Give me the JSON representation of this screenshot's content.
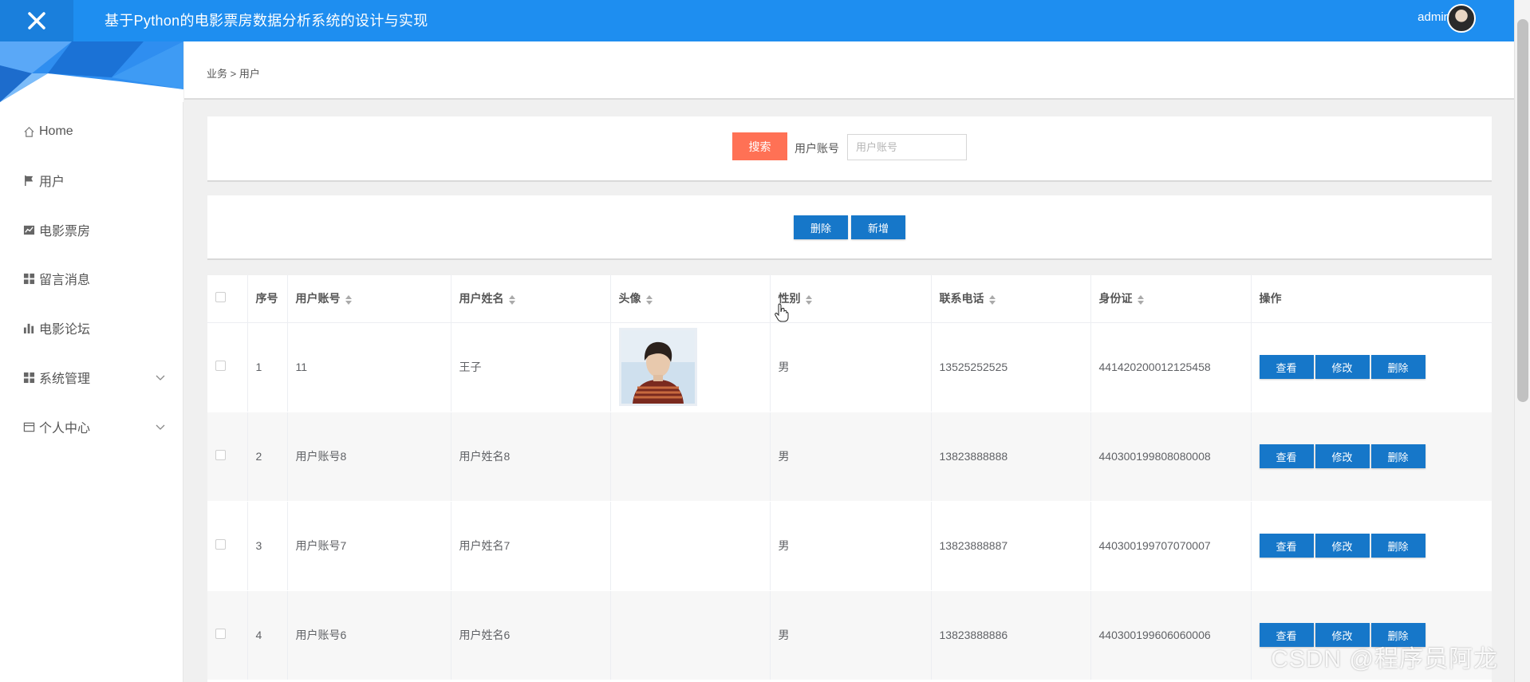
{
  "header": {
    "app_title": "基于Python的电影票房数据分析系统的设计与实现",
    "user_name": "admin",
    "brand_color": "#1e8ef0"
  },
  "sidebar": {
    "items": [
      {
        "label": "Home",
        "icon": "home-icon"
      },
      {
        "label": "用户",
        "icon": "flag-icon"
      },
      {
        "label": "电影票房",
        "icon": "chart-icon"
      },
      {
        "label": "留言消息",
        "icon": "grid-icon"
      },
      {
        "label": "电影论坛",
        "icon": "bar-chart-icon"
      },
      {
        "label": "系统管理",
        "icon": "grid-icon",
        "has_children": true
      },
      {
        "label": "个人中心",
        "icon": "card-icon",
        "has_children": true
      }
    ]
  },
  "breadcrumb": "业务 > 用户",
  "search": {
    "button_label": "搜索",
    "field_label": "用户账号",
    "placeholder": "用户账号",
    "value": "",
    "button_color": "#ff7155"
  },
  "actions": {
    "delete_label": "删除",
    "add_label": "新增",
    "button_color": "#1677c9"
  },
  "table": {
    "columns": [
      "序号",
      "用户账号",
      "用户姓名",
      "头像",
      "性别",
      "联系电话",
      "身份证",
      "操作"
    ],
    "row_action_labels": {
      "view": "查看",
      "edit": "修改",
      "delete": "删除"
    },
    "rows": [
      {
        "index": "1",
        "account": "11",
        "name": "王子",
        "has_avatar": true,
        "gender": "男",
        "phone": "13525252525",
        "id_card": "441420200012125458"
      },
      {
        "index": "2",
        "account": "用户账号8",
        "name": "用户姓名8",
        "has_avatar": false,
        "gender": "男",
        "phone": "13823888888",
        "id_card": "440300199808080008"
      },
      {
        "index": "3",
        "account": "用户账号7",
        "name": "用户姓名7",
        "has_avatar": false,
        "gender": "男",
        "phone": "13823888887",
        "id_card": "440300199707070007"
      },
      {
        "index": "4",
        "account": "用户账号6",
        "name": "用户姓名6",
        "has_avatar": false,
        "gender": "男",
        "phone": "13823888886",
        "id_card": "440300199606060006"
      }
    ]
  },
  "watermark": "CSDN @程序员阿龙"
}
